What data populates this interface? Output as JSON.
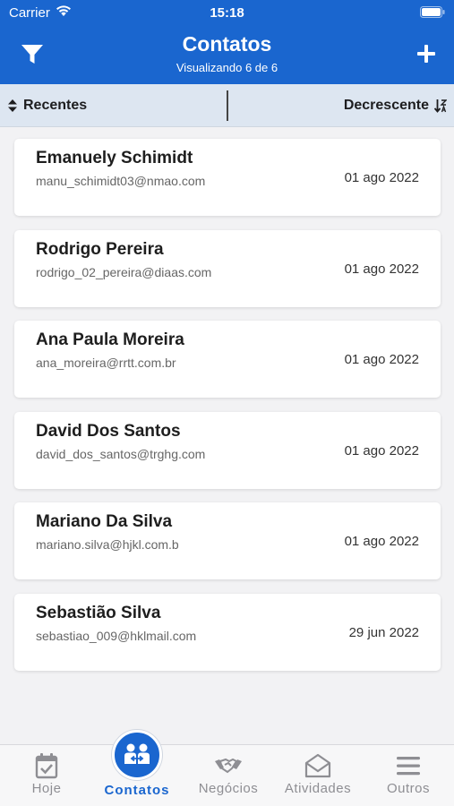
{
  "status_bar": {
    "carrier": "Carrier",
    "time": "15:18"
  },
  "header": {
    "title": "Contatos",
    "subtitle": "Visualizando 6 de 6",
    "filter_icon": "filter-icon",
    "add_icon": "plus-icon"
  },
  "sort": {
    "left_label": "Recentes",
    "right_label": "Decrescente"
  },
  "contacts": [
    {
      "name": "Emanuely Schimidt",
      "email": "manu_schimidt03@nmao.com",
      "date": "01 ago 2022"
    },
    {
      "name": "Rodrigo Pereira",
      "email": "rodrigo_02_pereira@diaas.com",
      "date": "01 ago 2022"
    },
    {
      "name": "Ana Paula Moreira",
      "email": "ana_moreira@rrtt.com.br",
      "date": "01 ago 2022"
    },
    {
      "name": "David Dos Santos",
      "email": "david_dos_santos@trghg.com",
      "date": "01 ago 2022"
    },
    {
      "name": "Mariano Da Silva",
      "email": "mariano.silva@hjkl.com.b",
      "date": "01 ago 2022"
    },
    {
      "name": "Sebastião Silva",
      "email": "sebastiao_009@hklmail.com",
      "date": "29 jun 2022"
    }
  ],
  "tabs": [
    {
      "label": "Hoje",
      "icon": "calendar-check-icon"
    },
    {
      "label": "Contatos",
      "icon": "contacts-icon",
      "active": true
    },
    {
      "label": "Negócios",
      "icon": "handshake-icon"
    },
    {
      "label": "Atividades",
      "icon": "envelope-icon"
    },
    {
      "label": "Outros",
      "icon": "menu-icon"
    }
  ],
  "colors": {
    "primary": "#1a66cf",
    "sort_bar": "#dde6f1",
    "background": "#f2f2f4",
    "inactive_tab": "#8e8e93"
  }
}
